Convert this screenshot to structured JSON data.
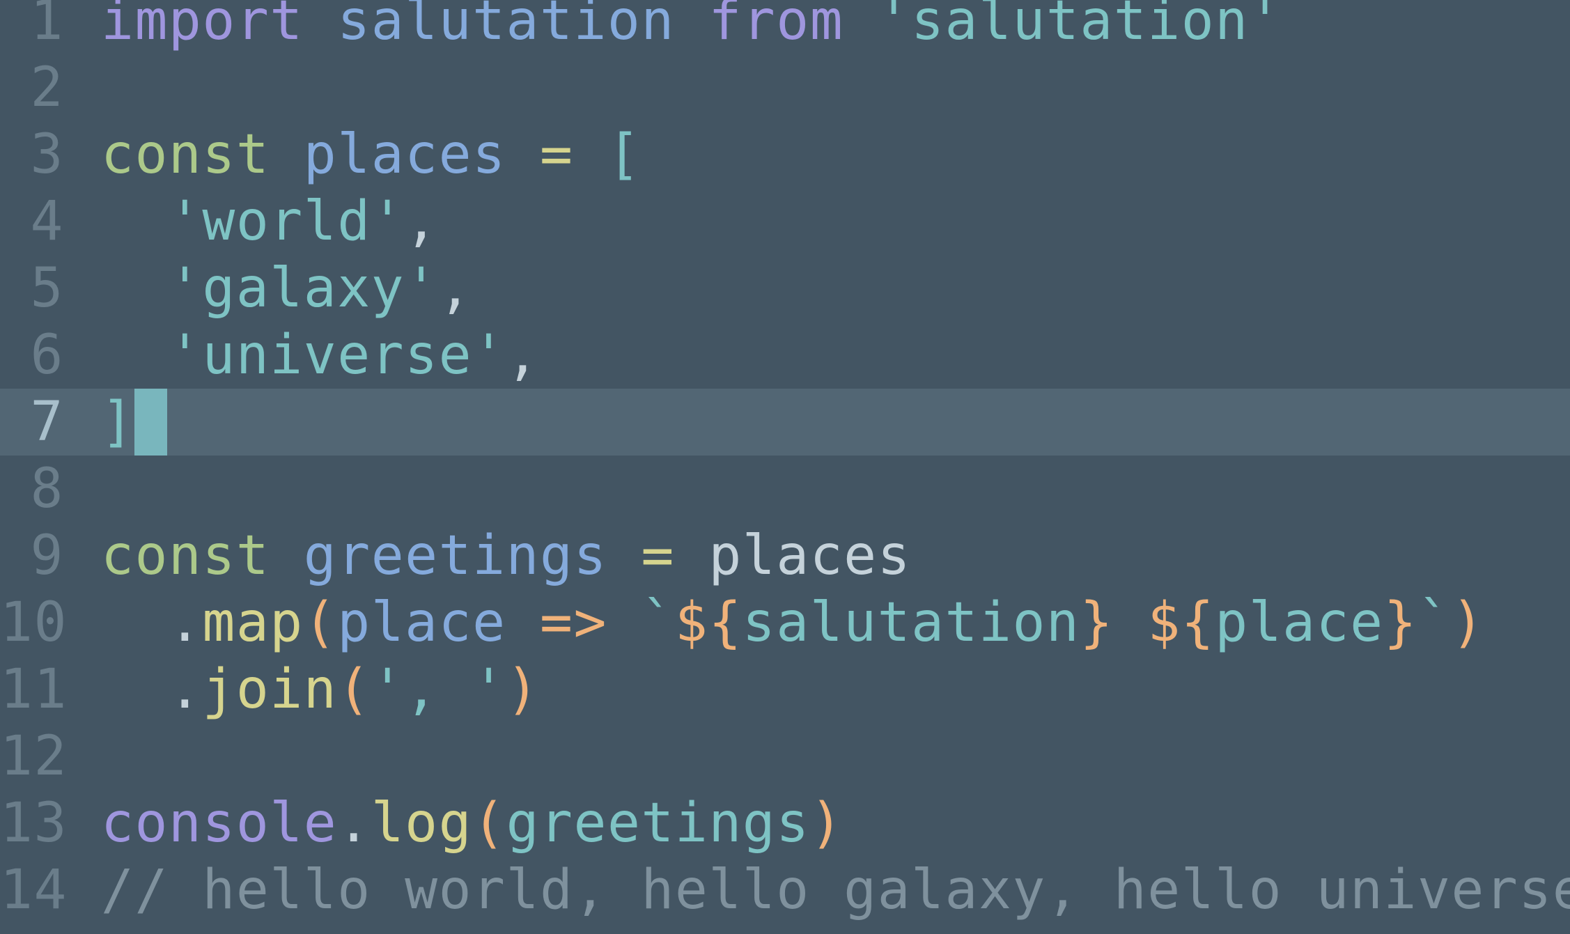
{
  "editor": {
    "colors": {
      "background": "#435563",
      "current_line": "#526674",
      "cursor": "#79b6bd",
      "keyword": "#9f96de",
      "declaration": "#acc98a",
      "identifier": "#85aadc",
      "string": "#7ec3c4",
      "punctuation": "#c5d2da",
      "bracket": "#7ec3c4",
      "function": "#d6d48e",
      "paren": "#f0b27a",
      "template_brace": "#f0b27a",
      "comment": "#7f919d",
      "line_number": "#6a7d8a"
    },
    "cursor_line": 7,
    "lines": [
      {
        "n": "1",
        "tokens": [
          {
            "t": "import",
            "c": "keyword"
          },
          {
            "t": " ",
            "c": "punctuation"
          },
          {
            "t": "salutation",
            "c": "identifier"
          },
          {
            "t": " ",
            "c": "punctuation"
          },
          {
            "t": "from",
            "c": "keyword"
          },
          {
            "t": " ",
            "c": "punctuation"
          },
          {
            "t": "'salutation'",
            "c": "string"
          }
        ]
      },
      {
        "n": "2",
        "tokens": []
      },
      {
        "n": "3",
        "tokens": [
          {
            "t": "const",
            "c": "declaration"
          },
          {
            "t": " ",
            "c": "punctuation"
          },
          {
            "t": "places",
            "c": "identifier"
          },
          {
            "t": " = ",
            "c": "function"
          },
          {
            "t": "[",
            "c": "bracket"
          }
        ]
      },
      {
        "n": "4",
        "tokens": [
          {
            "t": "  ",
            "c": "punctuation"
          },
          {
            "t": "'world'",
            "c": "string"
          },
          {
            "t": ",",
            "c": "punctuation"
          }
        ]
      },
      {
        "n": "5",
        "tokens": [
          {
            "t": "  ",
            "c": "punctuation"
          },
          {
            "t": "'galaxy'",
            "c": "string"
          },
          {
            "t": ",",
            "c": "punctuation"
          }
        ]
      },
      {
        "n": "6",
        "tokens": [
          {
            "t": "  ",
            "c": "punctuation"
          },
          {
            "t": "'universe'",
            "c": "string"
          },
          {
            "t": ",",
            "c": "punctuation"
          }
        ]
      },
      {
        "n": "7",
        "tokens": [
          {
            "t": "]",
            "c": "bracket"
          }
        ]
      },
      {
        "n": "8",
        "tokens": []
      },
      {
        "n": "9",
        "tokens": [
          {
            "t": "const",
            "c": "declaration"
          },
          {
            "t": " ",
            "c": "punctuation"
          },
          {
            "t": "greetings",
            "c": "identifier"
          },
          {
            "t": " = ",
            "c": "function"
          },
          {
            "t": "places",
            "c": "punctuation"
          }
        ]
      },
      {
        "n": "10",
        "tokens": [
          {
            "t": "  .",
            "c": "punctuation"
          },
          {
            "t": "map",
            "c": "function"
          },
          {
            "t": "(",
            "c": "paren"
          },
          {
            "t": "place",
            "c": "identifier"
          },
          {
            "t": " => ",
            "c": "paren"
          },
          {
            "t": "`",
            "c": "string"
          },
          {
            "t": "${",
            "c": "template_brace"
          },
          {
            "t": "salutation",
            "c": "string"
          },
          {
            "t": "}",
            "c": "template_brace"
          },
          {
            "t": " ",
            "c": "string"
          },
          {
            "t": "${",
            "c": "template_brace"
          },
          {
            "t": "place",
            "c": "string"
          },
          {
            "t": "}",
            "c": "template_brace"
          },
          {
            "t": "`",
            "c": "string"
          },
          {
            "t": ")",
            "c": "paren"
          }
        ]
      },
      {
        "n": "11",
        "tokens": [
          {
            "t": "  .",
            "c": "punctuation"
          },
          {
            "t": "join",
            "c": "function"
          },
          {
            "t": "(",
            "c": "paren"
          },
          {
            "t": "', '",
            "c": "string"
          },
          {
            "t": ")",
            "c": "paren"
          }
        ]
      },
      {
        "n": "12",
        "tokens": []
      },
      {
        "n": "13",
        "tokens": [
          {
            "t": "console",
            "c": "keyword"
          },
          {
            "t": ".",
            "c": "punctuation"
          },
          {
            "t": "log",
            "c": "function"
          },
          {
            "t": "(",
            "c": "paren"
          },
          {
            "t": "greetings",
            "c": "string"
          },
          {
            "t": ")",
            "c": "paren"
          }
        ]
      },
      {
        "n": "14",
        "tokens": [
          {
            "t": "// hello world, hello galaxy, hello universe",
            "c": "comment"
          }
        ]
      }
    ]
  }
}
